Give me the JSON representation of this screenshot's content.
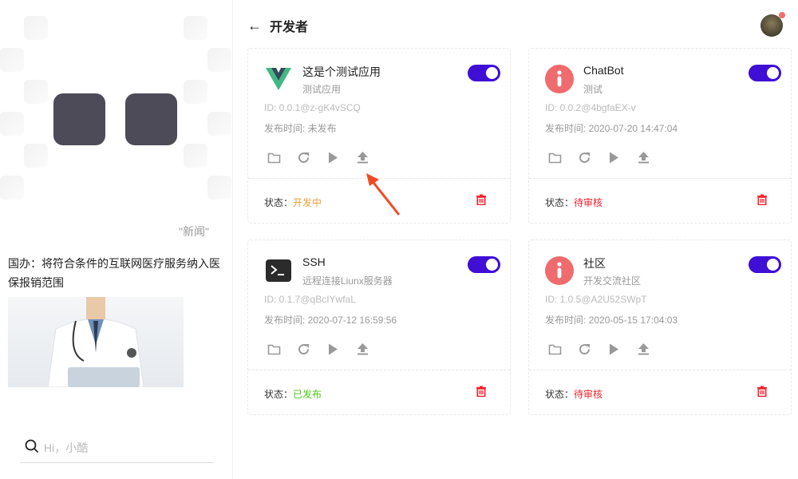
{
  "header": {
    "title": "开发者",
    "back_icon": "arrow-left-icon"
  },
  "news": {
    "tag": "\"新闻\"",
    "title": "国办：将符合条件的互联网医疗服务纳入医保报销范围"
  },
  "search": {
    "placeholder": "Hi，小酷"
  },
  "labels": {
    "status": "状态："
  },
  "cards": [
    {
      "name": "这是个测试应用",
      "desc": "测试应用",
      "id": "ID: 0.0.1@z-gK4vSCQ",
      "time": "发布时间: 未发布",
      "status": "开发中",
      "status_color": "#e6a23c",
      "enabled": true,
      "logo": "vue-logo"
    },
    {
      "name": "ChatBot",
      "desc": "测试",
      "id": "ID: 0.0.2@4bgfaEX-v",
      "time": "发布时间: 2020-07-20 14:47:04",
      "status": "待审核",
      "status_color": "#f5222d",
      "enabled": true,
      "logo": "info-icon"
    },
    {
      "name": "SSH",
      "desc": "远程连接Liunx服务器",
      "id": "ID: 0.1.7@qBcIYwfaL",
      "time": "发布时间: 2020-07-12 16:59:56",
      "status": "已发布",
      "status_color": "#52c41a",
      "enabled": true,
      "logo": "terminal-icon"
    },
    {
      "name": "社区",
      "desc": "开发交流社区",
      "id": "ID: 1.0.5@A2U52SWpT",
      "time": "发布时间: 2020-05-15 17:04:03",
      "status": "待审核",
      "status_color": "#f5222d",
      "enabled": true,
      "logo": "info-icon"
    }
  ]
}
